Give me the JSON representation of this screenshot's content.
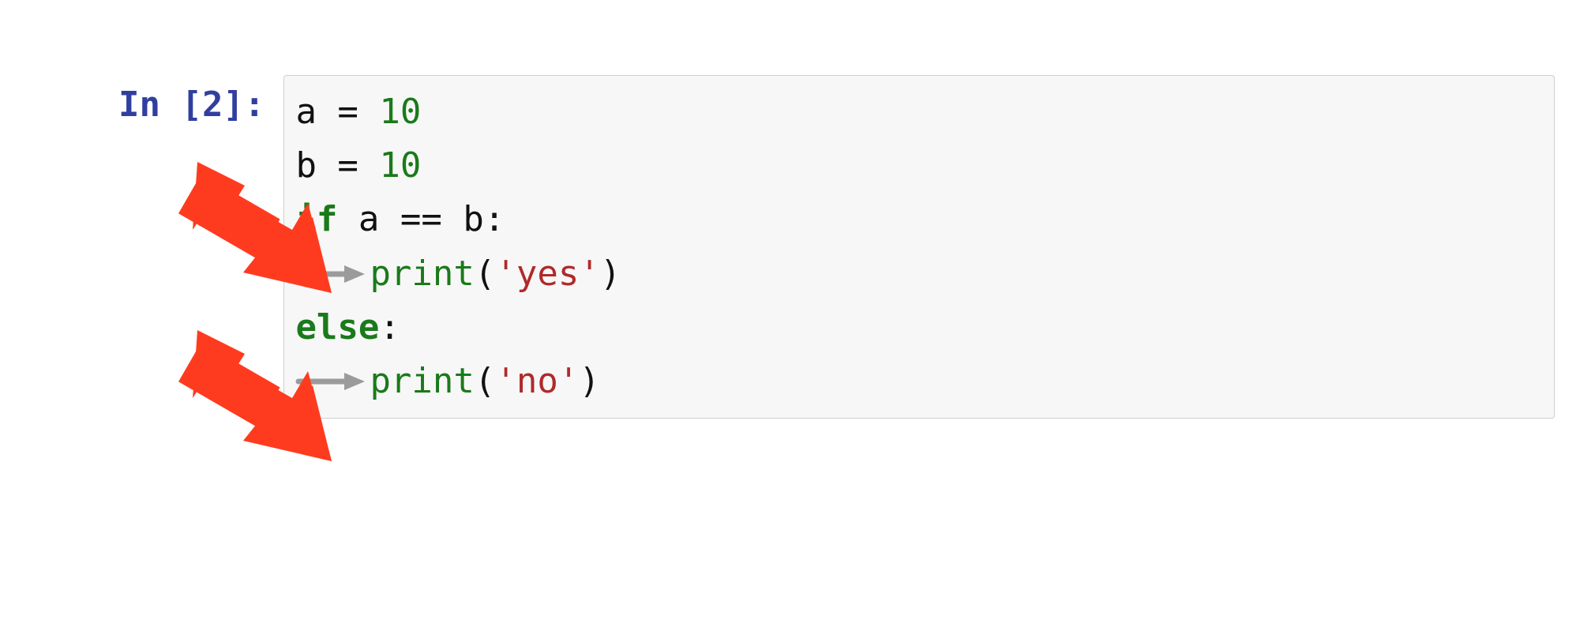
{
  "prompt": {
    "label": "In [2]:"
  },
  "code": {
    "line1": {
      "var": "a",
      "assign": " = ",
      "value": "10"
    },
    "line2": {
      "var": "b",
      "assign": " = ",
      "value": "10"
    },
    "line3": {
      "kw": "if",
      "space1": " ",
      "lhs": "a",
      "op": " == ",
      "rhs": "b",
      "colon": ":"
    },
    "line4": {
      "fn": "print",
      "lparen": "(",
      "str": "'yes'",
      "rparen": ")"
    },
    "line5": {
      "kw": "else",
      "colon": ":"
    },
    "line6": {
      "fn": "print",
      "lparen": "(",
      "str": "'no'",
      "rparen": ")"
    }
  },
  "indent_marker": "→",
  "annotations": [
    "top-red-arrow",
    "bottom-red-arrow"
  ],
  "colors": {
    "prompt_color": "#303f9f",
    "keyword_color": "#1a7a1a",
    "string_color": "#b02a2a",
    "arrow_red": "#ff3b1f",
    "indent_gray": "#9b9b9b"
  }
}
